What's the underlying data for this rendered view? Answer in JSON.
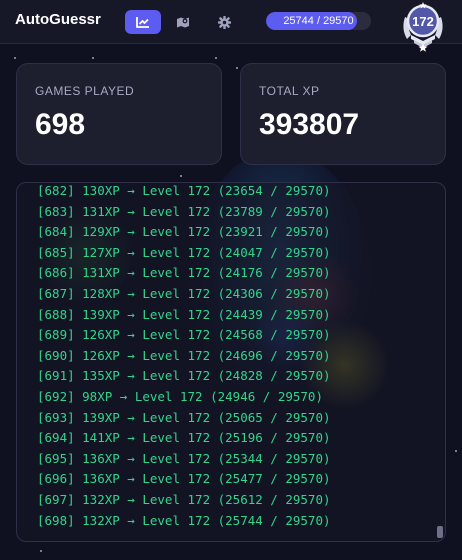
{
  "app": {
    "title": "AutoGuessr"
  },
  "nav": {
    "items": [
      {
        "icon": "chart-icon",
        "active": true
      },
      {
        "icon": "map-icon",
        "active": false
      },
      {
        "icon": "gear-icon",
        "active": false
      }
    ]
  },
  "xp": {
    "current": 25744,
    "max": 29570,
    "label": "25744 / 29570"
  },
  "level": {
    "number": "172",
    "icon": "rank-badge-icon"
  },
  "stats": {
    "games_played": {
      "label": "GAMES PLAYED",
      "value": "698"
    },
    "total_xp": {
      "label": "TOTAL XP",
      "value": "393807"
    }
  },
  "colors": {
    "accent": "#5d5cf0",
    "log_text": "#34d48b",
    "background": "#0f1020",
    "card": "#1e1f2f"
  },
  "log": {
    "lines": [
      "[682] 130XP → Level 172 (23654 / 29570)",
      "[683] 131XP → Level 172 (23789 / 29570)",
      "[684] 129XP → Level 172 (23921 / 29570)",
      "[685] 127XP → Level 172 (24047 / 29570)",
      "[686] 131XP → Level 172 (24176 / 29570)",
      "[687] 128XP → Level 172 (24306 / 29570)",
      "[688] 139XP → Level 172 (24439 / 29570)",
      "[689] 126XP → Level 172 (24568 / 29570)",
      "[690] 126XP → Level 172 (24696 / 29570)",
      "[691] 135XP → Level 172 (24828 / 29570)",
      "[692] 98XP → Level 172 (24946 / 29570)",
      "[693] 139XP → Level 172 (25065 / 29570)",
      "[694] 141XP → Level 172 (25196 / 29570)",
      "[695] 136XP → Level 172 (25344 / 29570)",
      "[696] 136XP → Level 172 (25477 / 29570)",
      "[697] 132XP → Level 172 (25612 / 29570)",
      "[698] 132XP → Level 172 (25744 / 29570)"
    ]
  }
}
